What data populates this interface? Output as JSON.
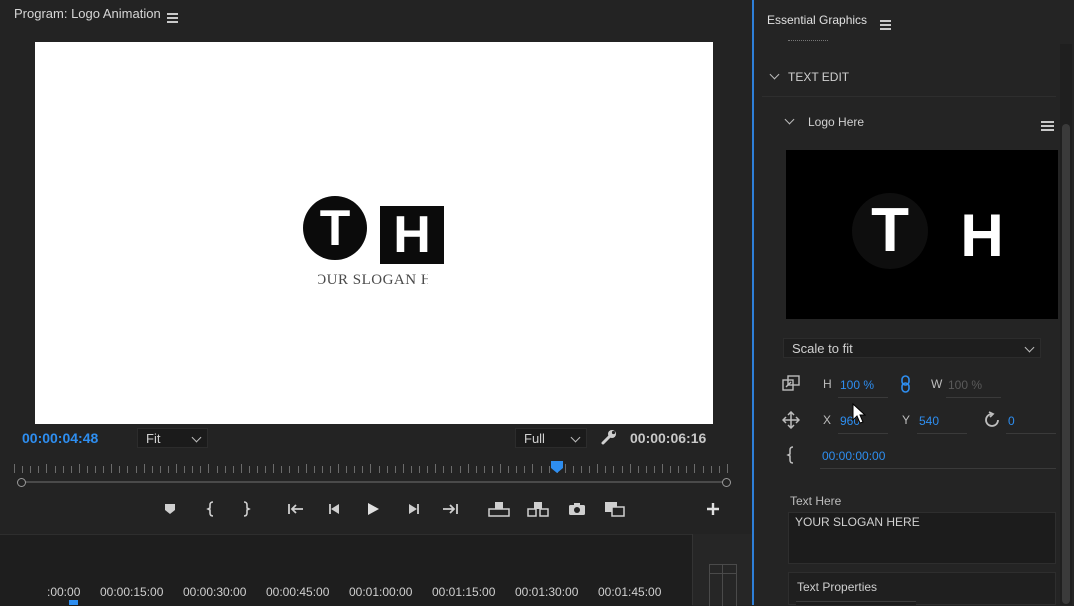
{
  "program": {
    "title": "Program: Logo Animation",
    "canvas": {
      "logo_left_letter": "T",
      "logo_right_letter": "H",
      "slogan_visible": "YOUR SLOGAN HERE"
    },
    "current_timecode": "00:00:04:48",
    "zoom": {
      "selected": "Fit"
    },
    "resolution": {
      "selected": "Full"
    },
    "duration_timecode": "00:00:06:16",
    "controls": [
      "add-marker",
      "mark-in",
      "mark-out",
      "go-to-in",
      "step-back",
      "play",
      "step-forward",
      "go-to-out",
      "lift",
      "extract",
      "export-frame",
      "comparison-view",
      "add-button"
    ],
    "playhead_position": 0.76,
    "timeline_labels": [
      ":00:00",
      "00:00:15:00",
      "00:00:30:00",
      "00:00:45:00",
      "00:01:00:00",
      "00:01:15:00",
      "00:01:30:00",
      "00:01:45:00"
    ]
  },
  "essential_graphics": {
    "title": "Essential Graphics",
    "section": "TEXT EDIT",
    "layer_name": "Logo Here",
    "thumbnail": {
      "left_letter": "T",
      "right_letter": "H"
    },
    "scale_mode": "Scale to fit",
    "transform": {
      "h_label": "H",
      "h_value": "100 %",
      "w_label": "W",
      "w_value": "100 %",
      "x_label": "X",
      "x_value": "960",
      "y_label": "Y",
      "y_value": "540",
      "rotation": "0",
      "timecode": "00:00:00:00"
    },
    "text_here_label": "Text Here",
    "text_here_value": "YOUR SLOGAN HERE",
    "text_properties_label": "Text Properties"
  },
  "colors": {
    "accent": "#2e8ef0",
    "panel_bg": "#232323",
    "canvas_bg": "#ffffff"
  }
}
